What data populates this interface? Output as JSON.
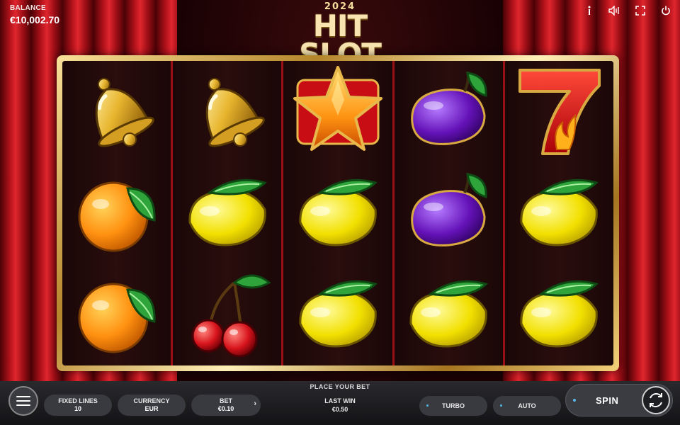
{
  "balance": {
    "label": "BALANCE",
    "value": "€10,002.70"
  },
  "logo": {
    "year": "2024",
    "title": "HIT SLOT"
  },
  "top_icons": [
    "info-icon",
    "sound-icon",
    "fullscreen-icon",
    "power-icon"
  ],
  "reels": [
    [
      "bell",
      "orange",
      "orange"
    ],
    [
      "bell",
      "lemon",
      "cherry"
    ],
    [
      "star",
      "lemon",
      "lemon"
    ],
    [
      "plum",
      "plum",
      "lemon"
    ],
    [
      "seven",
      "lemon",
      "lemon"
    ]
  ],
  "bottom": {
    "place_bet": "PLACE YOUR BET",
    "fixed_lines": {
      "label": "FIXED LINES",
      "value": "10"
    },
    "currency": {
      "label": "CURRENCY",
      "value": "EUR"
    },
    "bet": {
      "label": "BET",
      "value": "€0.10",
      "arrow": "›"
    },
    "last_win": {
      "label": "LAST WIN",
      "value": "€0.50"
    },
    "turbo": "TURBO",
    "auto": "AUTO",
    "spin": "SPIN"
  },
  "colors": {
    "curtain": "#c8161f",
    "gold": "#d9a941",
    "reel_divider": "#9b0f14"
  }
}
